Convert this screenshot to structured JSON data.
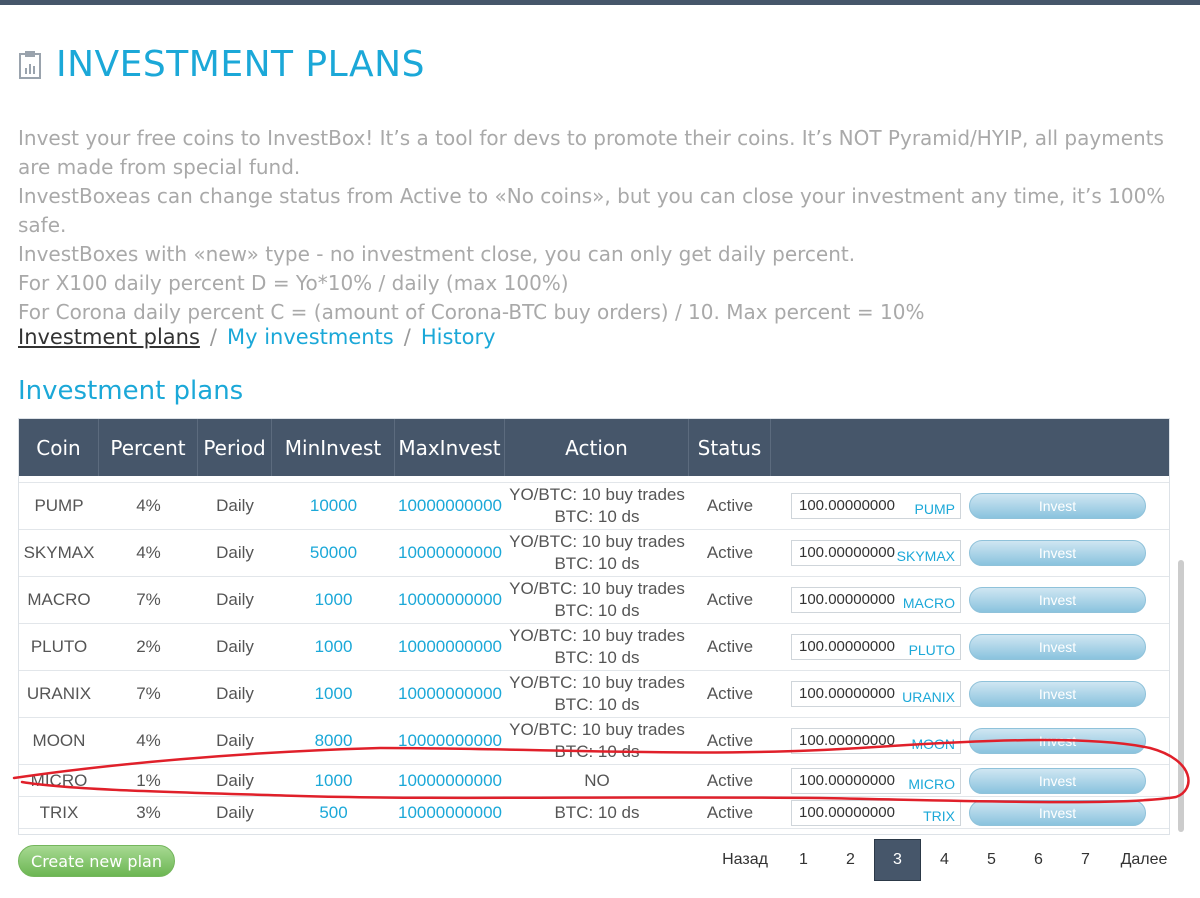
{
  "page": {
    "title": "INVESTMENT PLANS",
    "description": [
      "Invest your free coins to InvestBox! It’s a tool for devs to promote their coins. It’s NOT Pyramid/HYIP, all payments are made from special fund.",
      "InvestBoxeas can change status from Active to «No coins», but you can close your investment any time, it’s 100% safe.",
      "InvestBoxes with «new» type - no investment close, you can only get daily percent.",
      "For X100 daily percent D = Yo*10% / daily (max 100%)",
      "For Corona daily percent C = (amount of Corona-BTC buy orders) / 10. Max percent = 10%"
    ]
  },
  "nav": {
    "current": "Investment plans",
    "sep": "/",
    "my_investments": "My investments",
    "history": "History"
  },
  "section_title": "Investment plans",
  "table": {
    "headers": [
      "Coin",
      "Percent",
      "Period",
      "MinInvest",
      "MaxInvest",
      "Action",
      "Status"
    ],
    "partial_row_text": "BTC: 10 ds",
    "rows": [
      {
        "coin": "PUMP",
        "percent": "4%",
        "period": "Daily",
        "min": "10000",
        "max": "10000000000",
        "action1": "YO/BTC: 10 buy trades",
        "action2": "BTC: 10 ds",
        "status": "Active",
        "amount": "100.00000000",
        "currency": "PUMP",
        "button": "Invest"
      },
      {
        "coin": "SKYMAX",
        "percent": "4%",
        "period": "Daily",
        "min": "50000",
        "max": "10000000000",
        "action1": "YO/BTC: 10 buy trades",
        "action2": "BTC: 10 ds",
        "status": "Active",
        "amount": "100.00000000",
        "currency": "SKYMAX",
        "button": "Invest"
      },
      {
        "coin": "MACRO",
        "percent": "7%",
        "period": "Daily",
        "min": "1000",
        "max": "10000000000",
        "action1": "YO/BTC: 10 buy trades",
        "action2": "BTC: 10 ds",
        "status": "Active",
        "amount": "100.00000000",
        "currency": "MACRO",
        "button": "Invest"
      },
      {
        "coin": "PLUTO",
        "percent": "2%",
        "period": "Daily",
        "min": "1000",
        "max": "10000000000",
        "action1": "YO/BTC: 10 buy trades",
        "action2": "BTC: 10 ds",
        "status": "Active",
        "amount": "100.00000000",
        "currency": "PLUTO",
        "button": "Invest"
      },
      {
        "coin": "URANIX",
        "percent": "7%",
        "period": "Daily",
        "min": "1000",
        "max": "10000000000",
        "action1": "YO/BTC: 10 buy trades",
        "action2": "BTC: 10 ds",
        "status": "Active",
        "amount": "100.00000000",
        "currency": "URANIX",
        "button": "Invest"
      },
      {
        "coin": "MOON",
        "percent": "4%",
        "period": "Daily",
        "min": "8000",
        "max": "10000000000",
        "action1": "YO/BTC: 10 buy trades",
        "action2": "BTC: 10 ds",
        "status": "Active",
        "amount": "100.00000000",
        "currency": "MOON",
        "button": "Invest"
      },
      {
        "coin": "MICRO",
        "percent": "1%",
        "period": "Daily",
        "min": "1000",
        "max": "10000000000",
        "action1": "NO",
        "action2": "",
        "status": "Active",
        "amount": "100.00000000",
        "currency": "MICRO",
        "button": "Invest"
      },
      {
        "coin": "TRIX",
        "percent": "3%",
        "period": "Daily",
        "min": "500",
        "max": "10000000000",
        "action1": "BTC: 10 ds",
        "action2": "",
        "status": "Active",
        "amount": "100.00000000",
        "currency": "TRIX",
        "button": "Invest"
      }
    ]
  },
  "create_button": "Create new plan",
  "pagination": {
    "prev": "Назад",
    "pages": [
      "1",
      "2",
      "3",
      "4",
      "5",
      "6",
      "7"
    ],
    "active": "3",
    "next": "Далее"
  },
  "colors": {
    "accent": "#1ba8d8",
    "header_bg": "#46566a",
    "annotation": "#e0202a"
  }
}
